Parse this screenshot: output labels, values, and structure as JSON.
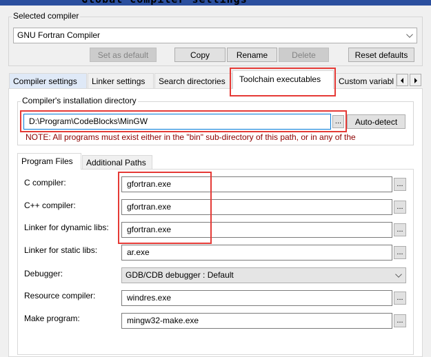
{
  "window": {
    "title": "Global compiler settings"
  },
  "selected_compiler": {
    "group_label": "Selected compiler",
    "value": "GNU Fortran Compiler",
    "buttons": {
      "set_default": "Set as default",
      "copy": "Copy",
      "rename": "Rename",
      "delete": "Delete",
      "reset": "Reset defaults"
    }
  },
  "tabs": [
    {
      "label": "Compiler settings"
    },
    {
      "label": "Linker settings"
    },
    {
      "label": "Search directories"
    },
    {
      "label": "Toolchain executables",
      "active": true
    },
    {
      "label": "Custom variabl"
    }
  ],
  "install_dir": {
    "group_label": "Compiler's installation directory",
    "value": "D:\\Program\\CodeBlocks\\MinGW",
    "browse_label": "...",
    "autodetect_label": "Auto-detect",
    "note": "NOTE: All programs must exist either in the \"bin\" sub-directory of this path, or in any of the"
  },
  "subtabs": [
    {
      "label": "Program Files",
      "active": true
    },
    {
      "label": "Additional Paths"
    }
  ],
  "programs": {
    "c_compiler": {
      "label": "C compiler:",
      "value": "gfortran.exe"
    },
    "cpp_compiler": {
      "label": "C++ compiler:",
      "value": "gfortran.exe"
    },
    "linker_dynamic": {
      "label": "Linker for dynamic libs:",
      "value": "gfortran.exe"
    },
    "linker_static": {
      "label": "Linker for static libs:",
      "value": "ar.exe"
    },
    "debugger": {
      "label": "Debugger:",
      "value": "GDB/CDB debugger : Default"
    },
    "resource_compiler": {
      "label": "Resource compiler:",
      "value": "windres.exe"
    },
    "make_program": {
      "label": "Make program:",
      "value": "mingw32-make.exe"
    },
    "browse_label": "..."
  },
  "colors": {
    "highlight": "#e53935",
    "note_text": "#8b0000",
    "titlebar": "#2b4f9e"
  }
}
